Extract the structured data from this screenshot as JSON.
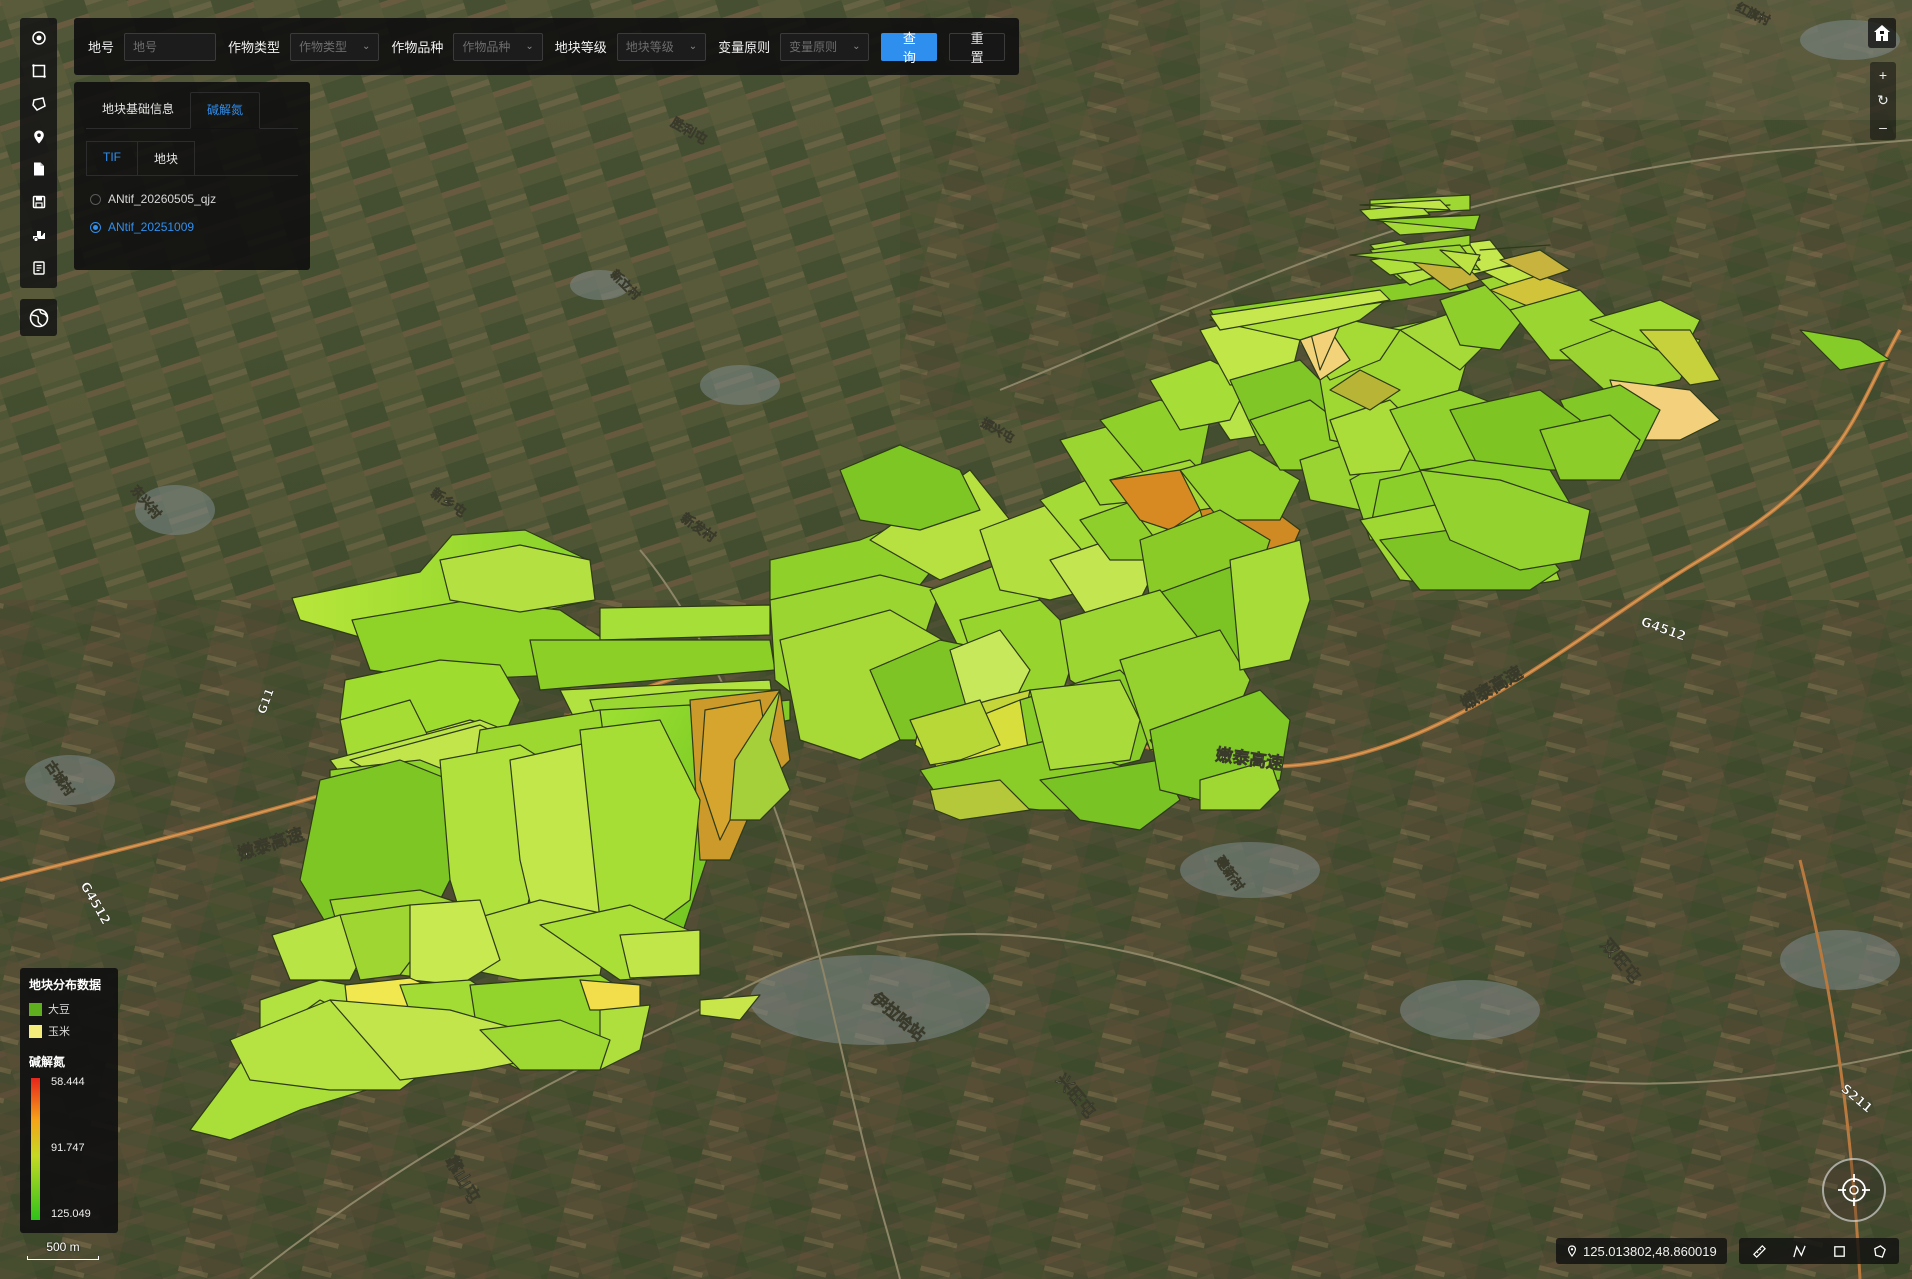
{
  "query_bar": {
    "plot_no_label": "地号",
    "plot_no_placeholder": "地号",
    "crop_type_label": "作物类型",
    "crop_type_placeholder": "作物类型",
    "crop_variety_label": "作物品种",
    "crop_variety_placeholder": "作物品种",
    "plot_grade_label": "地块等级",
    "plot_grade_placeholder": "地块等级",
    "variable_rule_label": "变量原则",
    "variable_rule_placeholder": "变量原则",
    "query_button": "查询",
    "reset_button": "重置"
  },
  "info_panel": {
    "tabs": [
      {
        "label": "地块基础信息",
        "active": false
      },
      {
        "label": "碱解氮",
        "active": true
      }
    ],
    "sub_tabs": [
      {
        "label": "TIF",
        "active": true
      },
      {
        "label": "地块",
        "active": false
      }
    ],
    "layers": [
      {
        "label": "ANtif_20260505_qjz",
        "selected": false
      },
      {
        "label": "ANtif_20251009",
        "selected": true
      }
    ]
  },
  "legend": {
    "title": "地块分布数据",
    "items": [
      {
        "label": "大豆",
        "color": "#5fae1d"
      },
      {
        "label": "玉米",
        "color": "#f3ec7a"
      }
    ],
    "ramp_title": "碱解氮",
    "ramp_values": [
      "58.444",
      "91.747",
      "125.049"
    ],
    "ramp_colors": [
      "#e8251c",
      "#f5a418",
      "#c5d923",
      "#2ec21a"
    ]
  },
  "scale": {
    "label": "500 m"
  },
  "coordinates": {
    "text": "125.013802,48.860019"
  },
  "map_labels": {
    "road_1": "嫩泰高速",
    "road_2": "嫩泰高速",
    "road_3": "嫩泰高速",
    "highway_1": "G4512",
    "highway_2": "G4512",
    "route_s211": "S211",
    "route_x": "G11",
    "village_1": "双旺屯",
    "village_2": "兴旺屯",
    "village_3": "靠山屯",
    "village_4": "建新村",
    "village_5": "古城村",
    "village_6": "东兴村",
    "village_7": "新乡屯",
    "village_8": "新发村",
    "village_9": "振兴屯",
    "village_10": "新立村",
    "village_11": "胜利屯",
    "village_12": "红旗村",
    "station": "伊拉哈站"
  },
  "colors": {
    "panel_bg": "#101010",
    "accent": "#2f8fef",
    "field_green": "#7fce2a",
    "field_yellow": "#f2e35a",
    "field_orange": "#d78a22"
  }
}
